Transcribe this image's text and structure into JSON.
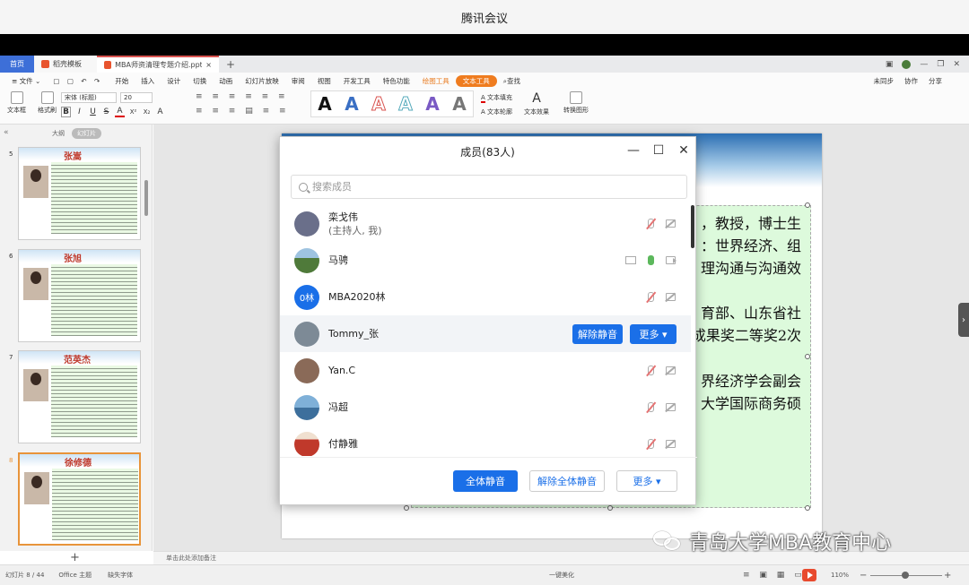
{
  "window": {
    "title": "腾讯会议"
  },
  "wps": {
    "home_tab": "首页",
    "tabs": [
      {
        "label": "稻壳模板",
        "color": "#e8542e"
      },
      {
        "label": "MBA师资清理专题介绍.pptx",
        "color": "#e8542e"
      }
    ],
    "new_tab": "+",
    "menus": [
      "≡ 文件 ⌄",
      "开始",
      "插入",
      "设计",
      "切换",
      "动画",
      "幻灯片放映",
      "审阅",
      "视图",
      "开发工具",
      "特色功能"
    ],
    "menu_orange": "绘图工具",
    "menu_pill": "文本工具",
    "menu_search": "查找",
    "menu_right": [
      "未同步",
      "协作",
      "分享"
    ],
    "ribbon": {
      "textbox_label": "文本框",
      "format_painter": "格式刷",
      "font_name": "宋体 (标题)",
      "font_size": "20",
      "fmt_buttons": [
        "B",
        "I",
        "U",
        "S",
        "A",
        "X²",
        "X₂",
        "A"
      ],
      "style_letters": [
        "A",
        "A",
        "A",
        "A",
        "A",
        "A"
      ],
      "text_fill": "文本填充",
      "text_outline": "文本轮廓",
      "text_effect": "文本效果",
      "convert_shape": "转换图形"
    }
  },
  "slides_panel": {
    "tab_outline": "大纲",
    "tab_slides": "幻灯片",
    "thumbs": [
      {
        "num": "5",
        "name": "张嵩"
      },
      {
        "num": "6",
        "name": "张旭"
      },
      {
        "num": "7",
        "name": "范英杰"
      },
      {
        "num": "8",
        "name": "徐修德"
      }
    ],
    "add": "+"
  },
  "slide": {
    "lines": [
      "，教授，博士生",
      "：世界经济、组",
      "理沟通与沟通效",
      "育部、山东省社",
      "成果奖二等奖2次",
      "界经济学会副会",
      "大学国际商务硕"
    ]
  },
  "notes": {
    "placeholder": "单击此处添加备注"
  },
  "status": {
    "slide_index": "幻灯片 8 / 44",
    "theme": "Office 主题",
    "missing_font": "缺失字体",
    "beautify": "一键美化",
    "zoom": "110%"
  },
  "watermark": {
    "text": "青岛大学MBA教育中心"
  },
  "members_dialog": {
    "title": "成员(83人)",
    "search_placeholder": "搜索成员",
    "members": [
      {
        "name": "栾戈伟",
        "sub": "(主持人, 我)",
        "avatar_color": "#6a6f8a",
        "mic": "muted",
        "cam": "off"
      },
      {
        "name": "马骋",
        "sub": "",
        "avatar_color": "#4f7a3a",
        "mic": "on",
        "cam": "off",
        "screen": true
      },
      {
        "name": "MBA2020林",
        "sub": "",
        "avatar_text": "0林",
        "avatar_color": "#1a6fe8",
        "mic": "muted",
        "cam": "off"
      },
      {
        "name": "Tommy_张",
        "sub": "",
        "avatar_color": "#7d8a96",
        "hover": true
      },
      {
        "name": "Yan.C",
        "sub": "",
        "avatar_color": "#8a6a58",
        "mic": "muted",
        "cam": "off"
      },
      {
        "name": "冯超",
        "sub": "",
        "avatar_color": "#3d6f9c",
        "mic": "muted",
        "cam": "off"
      },
      {
        "name": "付静雅",
        "sub": "",
        "avatar_color": "#c0392b",
        "mic": "muted",
        "cam": "off"
      }
    ],
    "row_actions": {
      "unmute": "解除静音",
      "more": "更多 ▾"
    },
    "footer": {
      "mute_all": "全体静音",
      "unmute_all": "解除全体静音",
      "more": "更多 ▾"
    }
  }
}
